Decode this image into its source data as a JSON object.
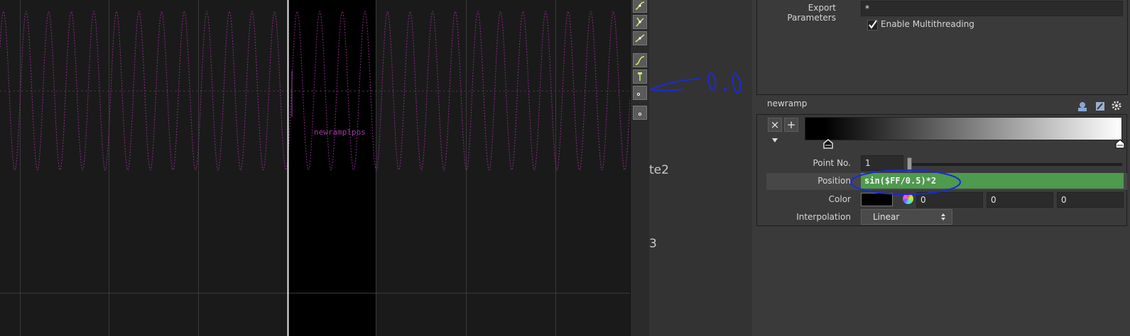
{
  "graph": {
    "curve_label": "newramplpos",
    "curve_color": "#8c2a8c"
  },
  "toolbar": {
    "buttons": [
      "bezier-tangent-icon",
      "break-tangent-icon",
      "linear-segment-icon",
      "ease-curve-icon",
      "pin-icon",
      "point-icon",
      "point-icon"
    ]
  },
  "network": {
    "node_fragment_1": "te2",
    "node_fragment_2": "3"
  },
  "export": {
    "export_parameters_label": "Export Parameters",
    "export_parameters_value": "*",
    "multithreading_label": "Enable Multithreading",
    "multithreading_checked": true
  },
  "ramp": {
    "name": "newramp",
    "remove_button": "×",
    "add_button": "+",
    "point_no_label": "Point No.",
    "point_no_value": "1",
    "position_label": "Position",
    "position_value": "sin($FF/0.5)*2",
    "color_label": "Color",
    "color_r": "0",
    "color_g": "0",
    "color_b": "0",
    "interpolation_label": "Interpolation",
    "interpolation_value": "Linear",
    "accent_color": "#4e9a4e"
  },
  "annotation": {
    "text": "0.0",
    "color": "#1a2bd6"
  }
}
